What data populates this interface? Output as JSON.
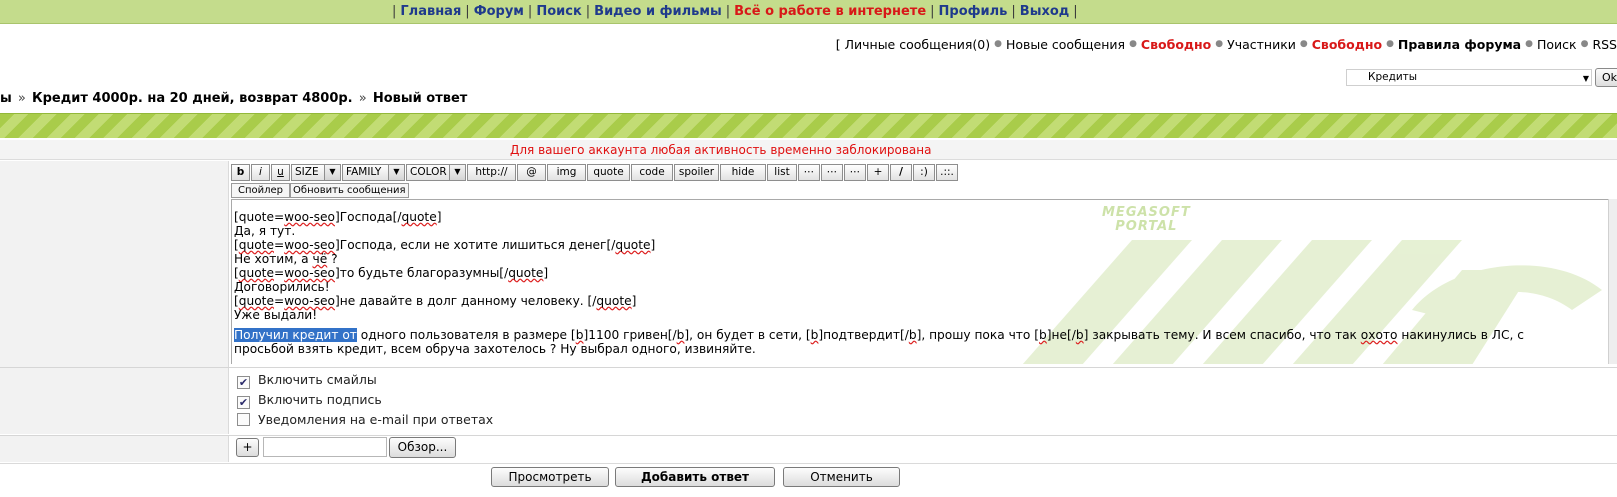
{
  "topnav": {
    "items": [
      "Главная",
      "Форум",
      "Поиск",
      "Видео и фильмы",
      "Всё о работе в интернете",
      "Профиль",
      "Выход"
    ]
  },
  "userbar": {
    "bracket": "[",
    "messages": "Личные сообщения(0)",
    "new_messages": "Новые сообщения",
    "free1": "Свободно",
    "members": "Участники",
    "free2": "Свободно",
    "rules": "Правила форума",
    "search": "Поиск",
    "rss": "RSS"
  },
  "forum_select": {
    "value": "Кредиты",
    "go_label": "Ok"
  },
  "breadcrumb": {
    "prefix": "ы",
    "topic": "Кредит 4000р. на 20 дней, возврат 4800р.",
    "current": "Новый ответ"
  },
  "notice": "Для вашего аккаунта любая активность временно заблокирована",
  "toolbar": {
    "b": "b",
    "i": "i",
    "u": "u",
    "size": "SIZE",
    "family": "FAMILY",
    "color": "COLOR",
    "http": "http://",
    "at": "@",
    "img": "img",
    "quote": "quote",
    "code": "code",
    "spoiler": "spoiler",
    "hide": "hide",
    "list": "list",
    "dots1": "⋯",
    "dots2": "⋯",
    "dots3": "⋯",
    "plus": "+",
    "slash": "/",
    "smile": ":)",
    "more": ".::.",
    "row2": {
      "spoiler": "Спойлер",
      "refresh": "Обновить сообщения"
    }
  },
  "editor": {
    "l0a": "[quote=",
    "l0b": "woo-seo",
    "l0c": "]Господа[/",
    "l0d": "quote",
    "l0e": "]",
    "l1": "Да, я тут.",
    "l2a": "[",
    "l2b": "quote",
    "l2c": "=",
    "l2d": "woo-seo",
    "l2e": "]Господа, если не хотите лишиться денег[/",
    "l2f": "quote",
    "l2g": "]",
    "l3a": "Не хотим, а ",
    "l3b": "чё",
    "l3c": " ?",
    "l4a": "[",
    "l4b": "quote",
    "l4c": "=",
    "l4d": "woo-seo",
    "l4e": "]то будьте благоразумны[/",
    "l4f": "quote",
    "l4g": "]",
    "l5": "Договорились!",
    "l6a": "[",
    "l6b": "quote",
    "l6c": "=",
    "l6d": "woo-seo",
    "l6e": "]не давайте в долг данному человеку. [/",
    "l6f": "quote",
    "l6g": "]",
    "l7": "Уже выдали!",
    "last_hl": "Получил кредит от",
    "last_a": " одного пользователя в размере [",
    "last_b": "b",
    "last_c": "]1100 гривен[/",
    "last_d": "b",
    "last_e": "], он будет в сети, [",
    "last_f": "b",
    "last_g": "]подтвердит[/",
    "last_h": "b",
    "last_i": "], прошу пока что [",
    "last_j": "b",
    "last_k": "]не[/",
    "last_l": "b",
    "last_m": "] закрывать тему. И всем спасибо, что так ",
    "last_n": "охото",
    "last_o": " накинулись в ЛС, с просьбой взять кредит, всем обруча захотелось ? Ну выбрал одного, извиняйте.",
    "watermark_line1": "MEGASOFT",
    "watermark_line2": "PORTAL"
  },
  "options": {
    "smiles": {
      "label": "Включить смайлы",
      "checked": true
    },
    "signature": {
      "label": "Включить подпись",
      "checked": true
    },
    "email": {
      "label": "Уведомления на e-mail при ответах",
      "checked": false
    }
  },
  "attach": {
    "plus": "+",
    "browse": "Обзор..."
  },
  "buttons": {
    "preview": "Просмотреть",
    "submit": "Добавить ответ",
    "cancel": "Отменить"
  },
  "colors": {
    "nav_bg": "#c4dc8c",
    "link": "#1f3a8c",
    "alert": "#e01010",
    "selection": "#3272c8"
  }
}
